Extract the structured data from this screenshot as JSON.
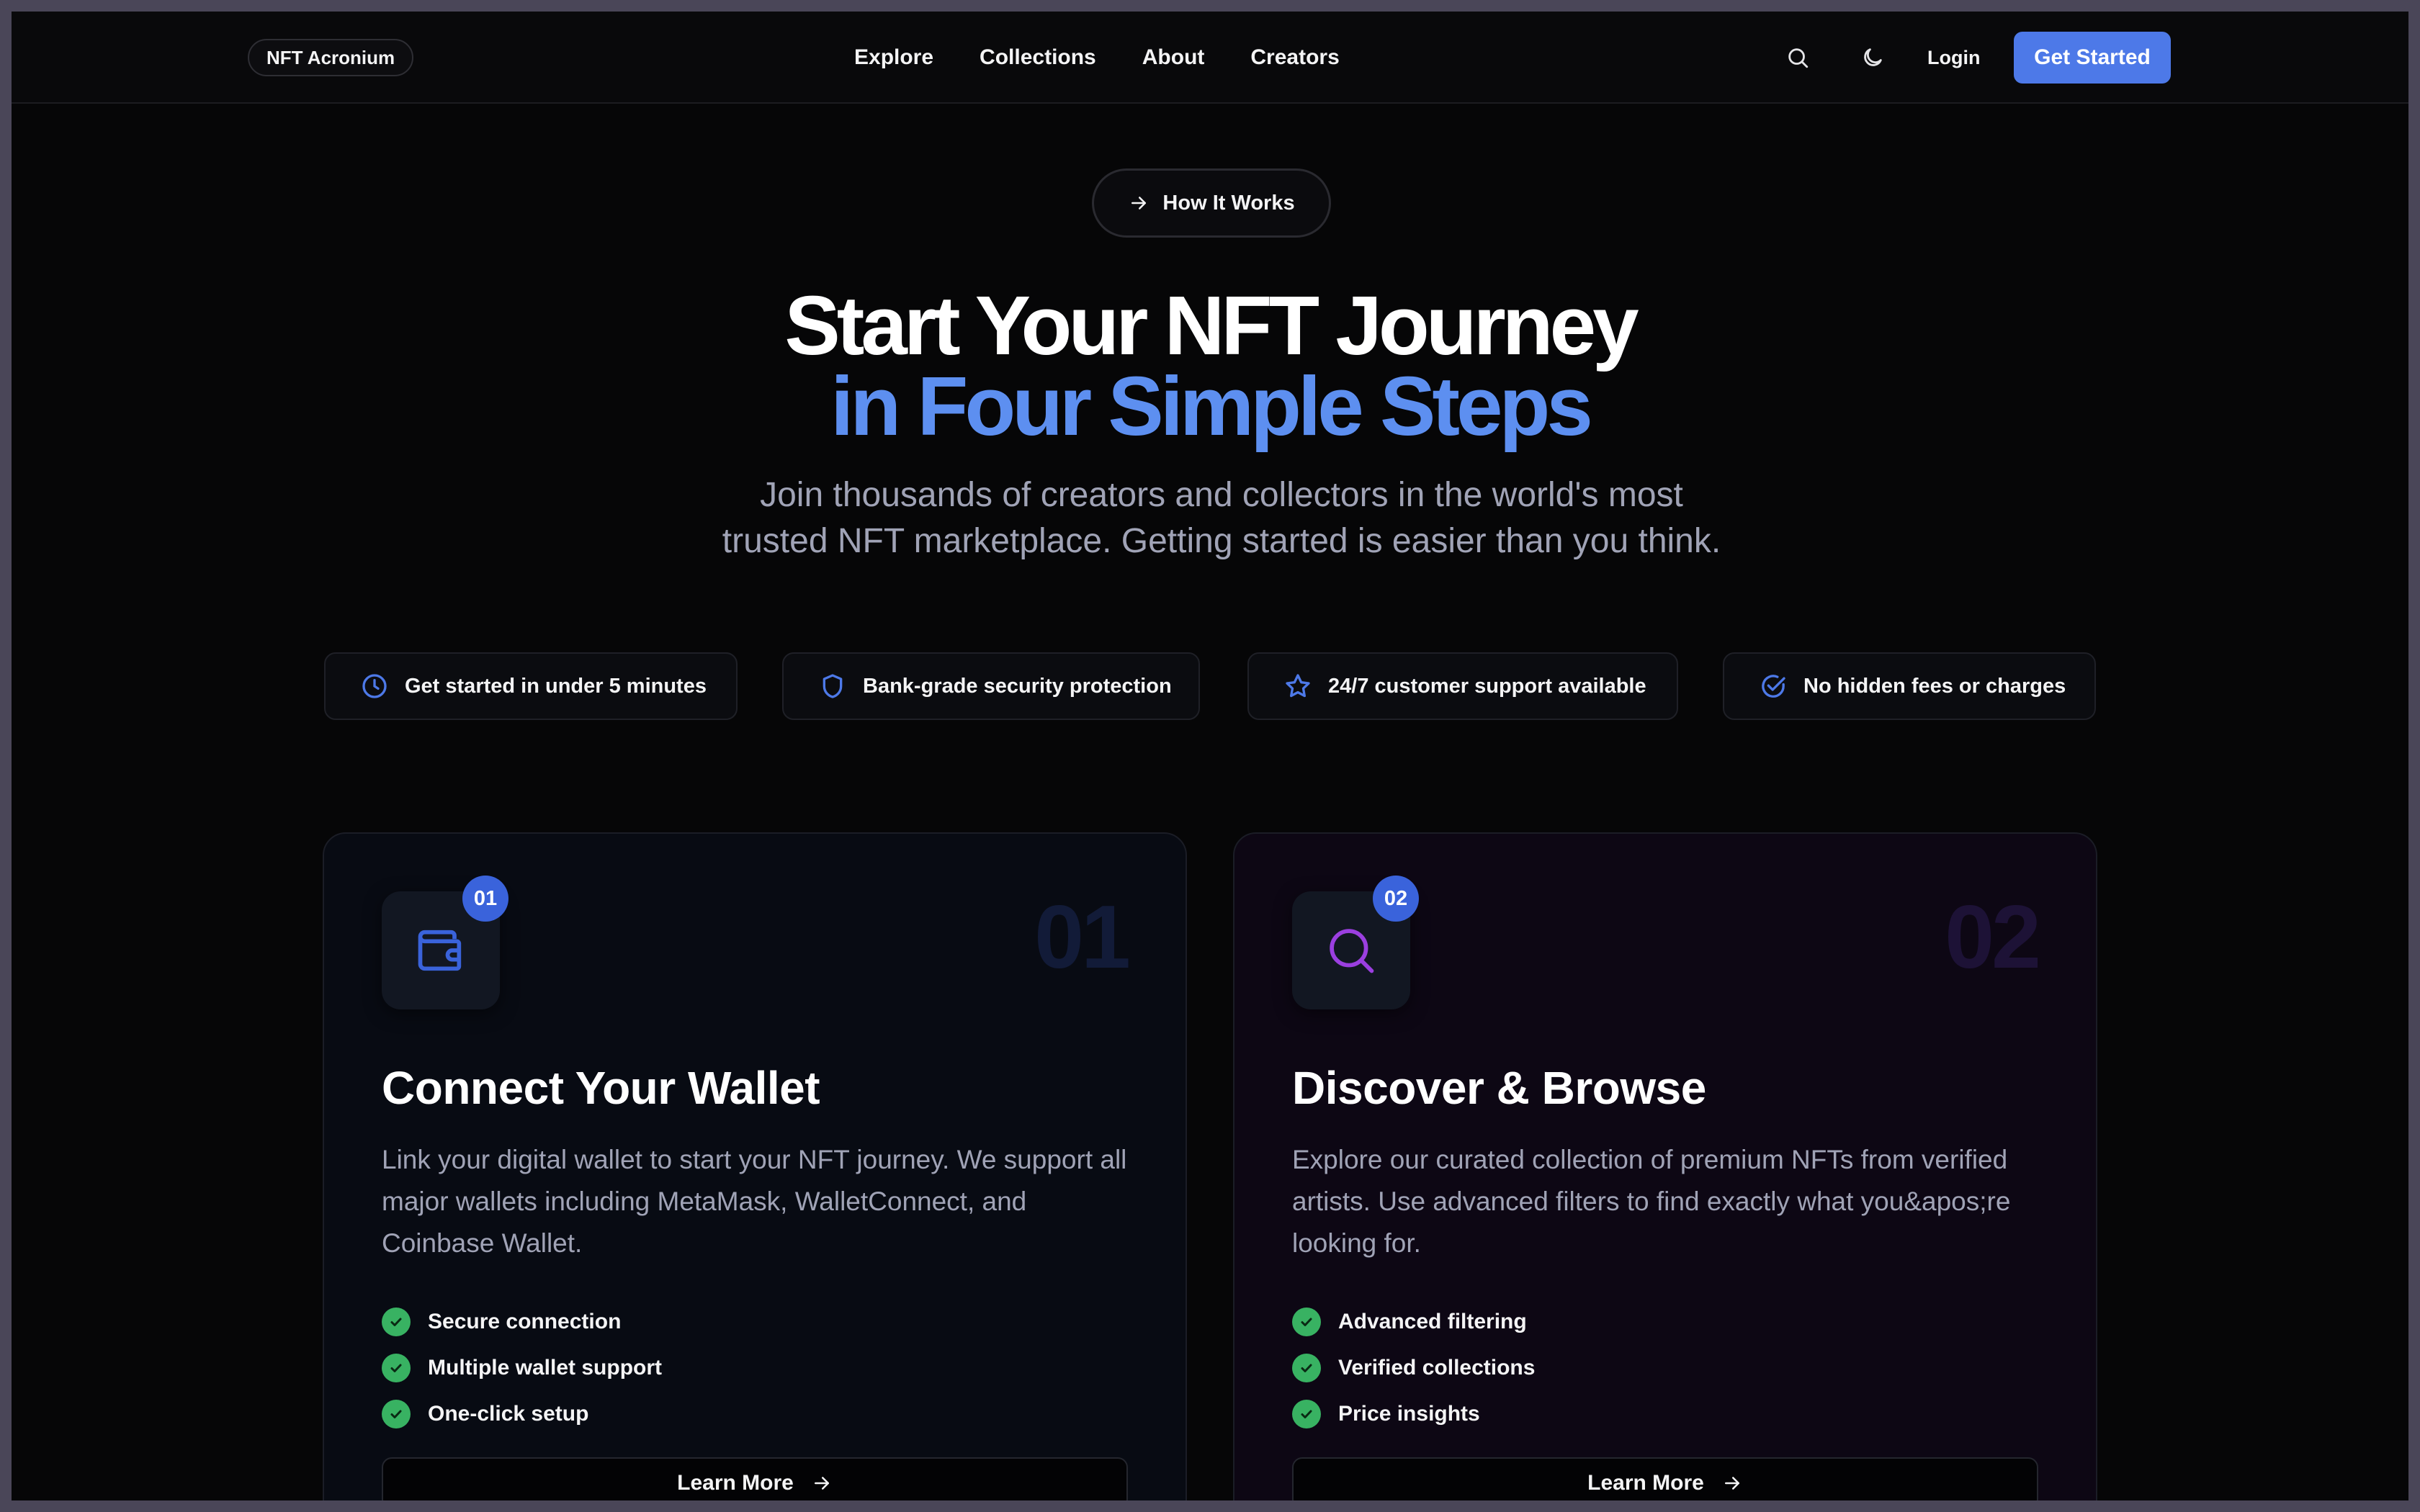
{
  "nav": {
    "brand": "NFT Acronium",
    "links": [
      "Explore",
      "Collections",
      "About",
      "Creators"
    ],
    "login": "Login",
    "cta": "Get Started"
  },
  "hero": {
    "pill": "How It Works",
    "title_line1": "Start Your NFT Journey",
    "title_line2": "in Four Simple Steps",
    "subtitle_line1": "Join thousands of creators and collectors in the world's most",
    "subtitle_line2": "trusted NFT marketplace. Getting started is easier than you think."
  },
  "features": [
    {
      "icon": "clock-icon",
      "label": "Get started in under 5 minutes"
    },
    {
      "icon": "shield-icon",
      "label": "Bank-grade security protection"
    },
    {
      "icon": "star-icon",
      "label": "24/7 customer support available"
    },
    {
      "icon": "check-circle-icon",
      "label": "No hidden fees or charges"
    }
  ],
  "steps": [
    {
      "badge": "01",
      "number": "01",
      "icon": "wallet-icon",
      "title": "Connect Your Wallet",
      "description": "Link your digital wallet to start your NFT journey. We support all major wallets including MetaMask, WalletConnect, and Coinbase Wallet.",
      "checks": [
        "Secure connection",
        "Multiple wallet support",
        "One-click setup"
      ],
      "button": "Learn More"
    },
    {
      "badge": "02",
      "number": "02",
      "icon": "search-icon",
      "title": "Discover & Browse",
      "description": "Explore our curated collection of premium NFTs from verified artists. Use advanced filters to find exactly what you&apos;re looking for.",
      "checks": [
        "Advanced filtering",
        "Verified collections",
        "Price insights"
      ],
      "button": "Learn More"
    }
  ],
  "colors": {
    "accent": "#4d79e8",
    "title_accent": "#5d8ff0",
    "check": "#38b262",
    "purple_icon": "#9b3fe0"
  }
}
